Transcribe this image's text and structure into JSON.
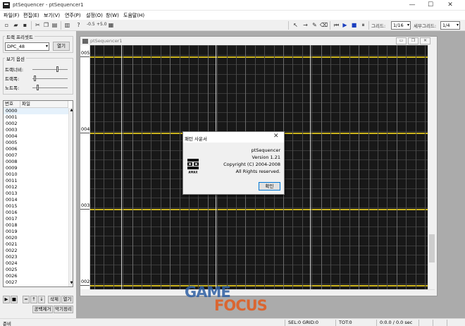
{
  "window": {
    "title": "ptSequencer - ptSequencer1",
    "min": "—",
    "max": "☐",
    "close": "✕"
  },
  "menu": [
    "파일(F)",
    "편집(E)",
    "보기(V)",
    "연주(P)",
    "설정(O)",
    "창(W)",
    "도움말(H)"
  ],
  "toolbar": {
    "zoom_out": "-0.5",
    "zoom_in": "+5.0",
    "grid_label": "그리드:",
    "grid_value": "1/16",
    "subgrid_label": "세부그리드:",
    "subgrid_value": "1/4"
  },
  "preset": {
    "title": "트랙 프리셋트",
    "value": "DPC_48",
    "open": "열기"
  },
  "view_options": {
    "title": "보기 옵션",
    "sliders": [
      {
        "label": "트랙너비:",
        "level": 0.72
      },
      {
        "label": "트랙폭:",
        "level": 0.05
      },
      {
        "label": "노트폭:",
        "level": 0.12
      }
    ]
  },
  "tracklist": {
    "columns": [
      "번호",
      "파일"
    ],
    "rows": [
      "0000",
      "0001",
      "0002",
      "0003",
      "0004",
      "0005",
      "0006",
      "0007",
      "0008",
      "0009",
      "0010",
      "0011",
      "0012",
      "0013",
      "0014",
      "0015",
      "0016",
      "0017",
      "0018",
      "0019",
      "0020",
      "0021",
      "0022",
      "0023",
      "0024",
      "0025",
      "0026",
      "0027"
    ]
  },
  "controls": {
    "play": "▶",
    "stop": "■",
    "b1": "=",
    "b2": "↑",
    "b3": "↓",
    "delete": "삭제",
    "open": "열기",
    "clean_space": "공백제거",
    "sort_instr": "악기정리"
  },
  "child": {
    "title": "ptSequencer1",
    "measures": [
      "005",
      "004",
      "003",
      "002"
    ]
  },
  "dialog": {
    "title": "패턴 사운서",
    "app": "ptSequencer",
    "version": "Version 1.21",
    "copyright": "Copyright (C) 2004-2008",
    "rights": "All Rights reserved.",
    "logo_text": "AMAX",
    "ok": "확인"
  },
  "status": {
    "ready": "준비",
    "sel": "SEL:0 GRID:0",
    "tot": "TOT:0",
    "time": "0:0.0 / 0.0 sec"
  },
  "watermark": {
    "line1": "GAME",
    "line2": "FOCUS"
  },
  "colors": {
    "grid_bg": "#181818",
    "measure_line": "#c9b21e",
    "beat_line": "#6c6c6c",
    "accent_line": "#d0d0d0"
  }
}
